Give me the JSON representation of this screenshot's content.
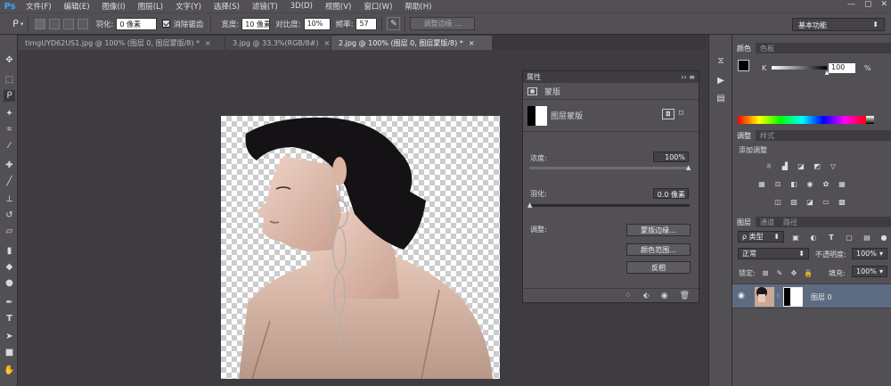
{
  "app": {
    "logo": "Ps"
  },
  "menu": [
    "文件(F)",
    "编辑(E)",
    "图像(I)",
    "图层(L)",
    "文字(Y)",
    "选择(S)",
    "滤镜(T)",
    "3D(D)",
    "视图(V)",
    "窗口(W)",
    "帮助(H)"
  ],
  "window_controls": {
    "minimize": "—",
    "maximize": "▢",
    "close": "✕"
  },
  "options": {
    "feather_label": "羽化:",
    "feather_value": "0 像素",
    "antialias_label": "消除锯齿",
    "width_label": "宽度:",
    "width_value": "10 像素",
    "contrast_label": "对比度:",
    "contrast_value": "10%",
    "frequency_label": "频率:",
    "frequency_value": "57",
    "refine_edge": "调整边缘 ...",
    "workspace": "基本功能"
  },
  "tabs": [
    {
      "label": "timgUYD62US1.jpg @ 100% (图层 0, 图层蒙版/8) *",
      "close": "×"
    },
    {
      "label": "3.jpg @ 33.3%(RGB/8#)",
      "close": "×"
    },
    {
      "label": "2.jpg @ 100% (图层 0, 图层蒙版/8) *",
      "close": "×"
    }
  ],
  "properties": {
    "title": "属性",
    "header_icons": "›› ≡",
    "mask_label": "蒙版",
    "layer_mask_label": "图层蒙版",
    "density_label": "浓度:",
    "density_value": "100%",
    "density": 1.0,
    "feather_label": "羽化:",
    "feather_value": "0.0 像素",
    "feather": 0.0,
    "refine_label": "调整:",
    "mask_edge_button": "蒙版边缘...",
    "color_range_button": "颜色范围...",
    "invert_button": "反相"
  },
  "color_panel": {
    "tabs": [
      "颜色",
      "色板"
    ],
    "channel_label": "K",
    "value": "100",
    "unit": "%",
    "level": 1.0
  },
  "adjust_panel": {
    "tabs": [
      "调整",
      "样式"
    ],
    "add_label": "添加调整"
  },
  "layers_panel": {
    "tabs": [
      "图层",
      "通道",
      "路径"
    ],
    "filter_kind": "ρ 类型",
    "blend_mode": "正常",
    "opacity_label": "不透明度:",
    "opacity_value": "100%",
    "lock_label": "锁定:",
    "fill_label": "填充:",
    "fill_value": "100%",
    "layer_name": "图层 0"
  },
  "colors": {
    "accent": "#31a8ff",
    "panel": "#535055",
    "dark": "#3e3c41",
    "selected_layer": "#5d6b82"
  }
}
